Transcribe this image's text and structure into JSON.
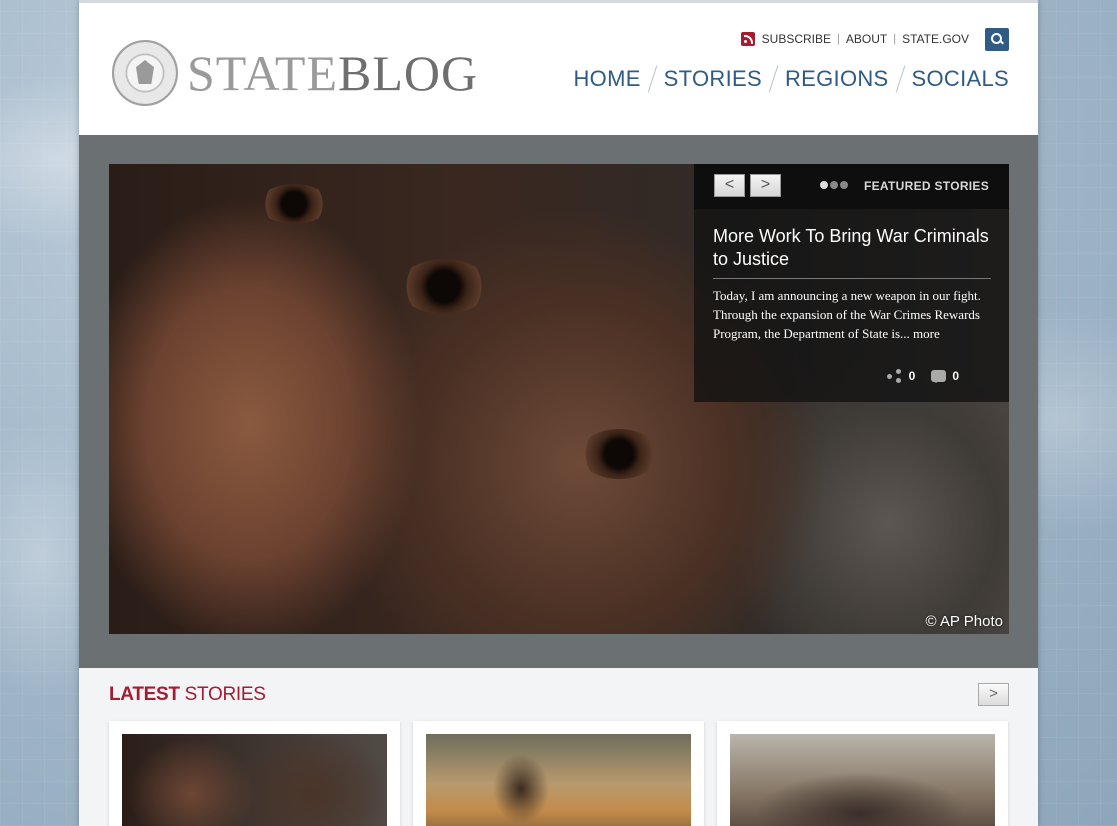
{
  "header": {
    "logo": {
      "part1": "STATE",
      "part2": "BLOG"
    },
    "utility_links": {
      "subscribe": "SUBSCRIBE",
      "about": "ABOUT",
      "state_gov": "STATE.GOV"
    },
    "nav": {
      "home": "HOME",
      "stories": "STORIES",
      "regions": "REGIONS",
      "socials": "SOCIALS"
    }
  },
  "hero": {
    "prev_label": "<",
    "next_label": ">",
    "featured_label": "FEATURED STORIES",
    "story_title": "More Work To Bring War Criminals to Justice",
    "story_excerpt": "Today, I am announcing a new weapon in our fight. Through the expansion of the War Crimes Rewards Program, the Department of State is...",
    "more_label": "more",
    "share_count": "0",
    "comment_count": "0",
    "photo_credit": "© AP Photo"
  },
  "latest": {
    "title_bold": "LATEST",
    "title_rest": " STORIES",
    "next_label": ">"
  },
  "icons": {
    "rss": "rss-icon",
    "search": "search-icon",
    "share": "share-icon",
    "comment": "comment-icon"
  },
  "colors": {
    "brand_red": "#a51c30",
    "nav_blue": "#2f5b85"
  }
}
